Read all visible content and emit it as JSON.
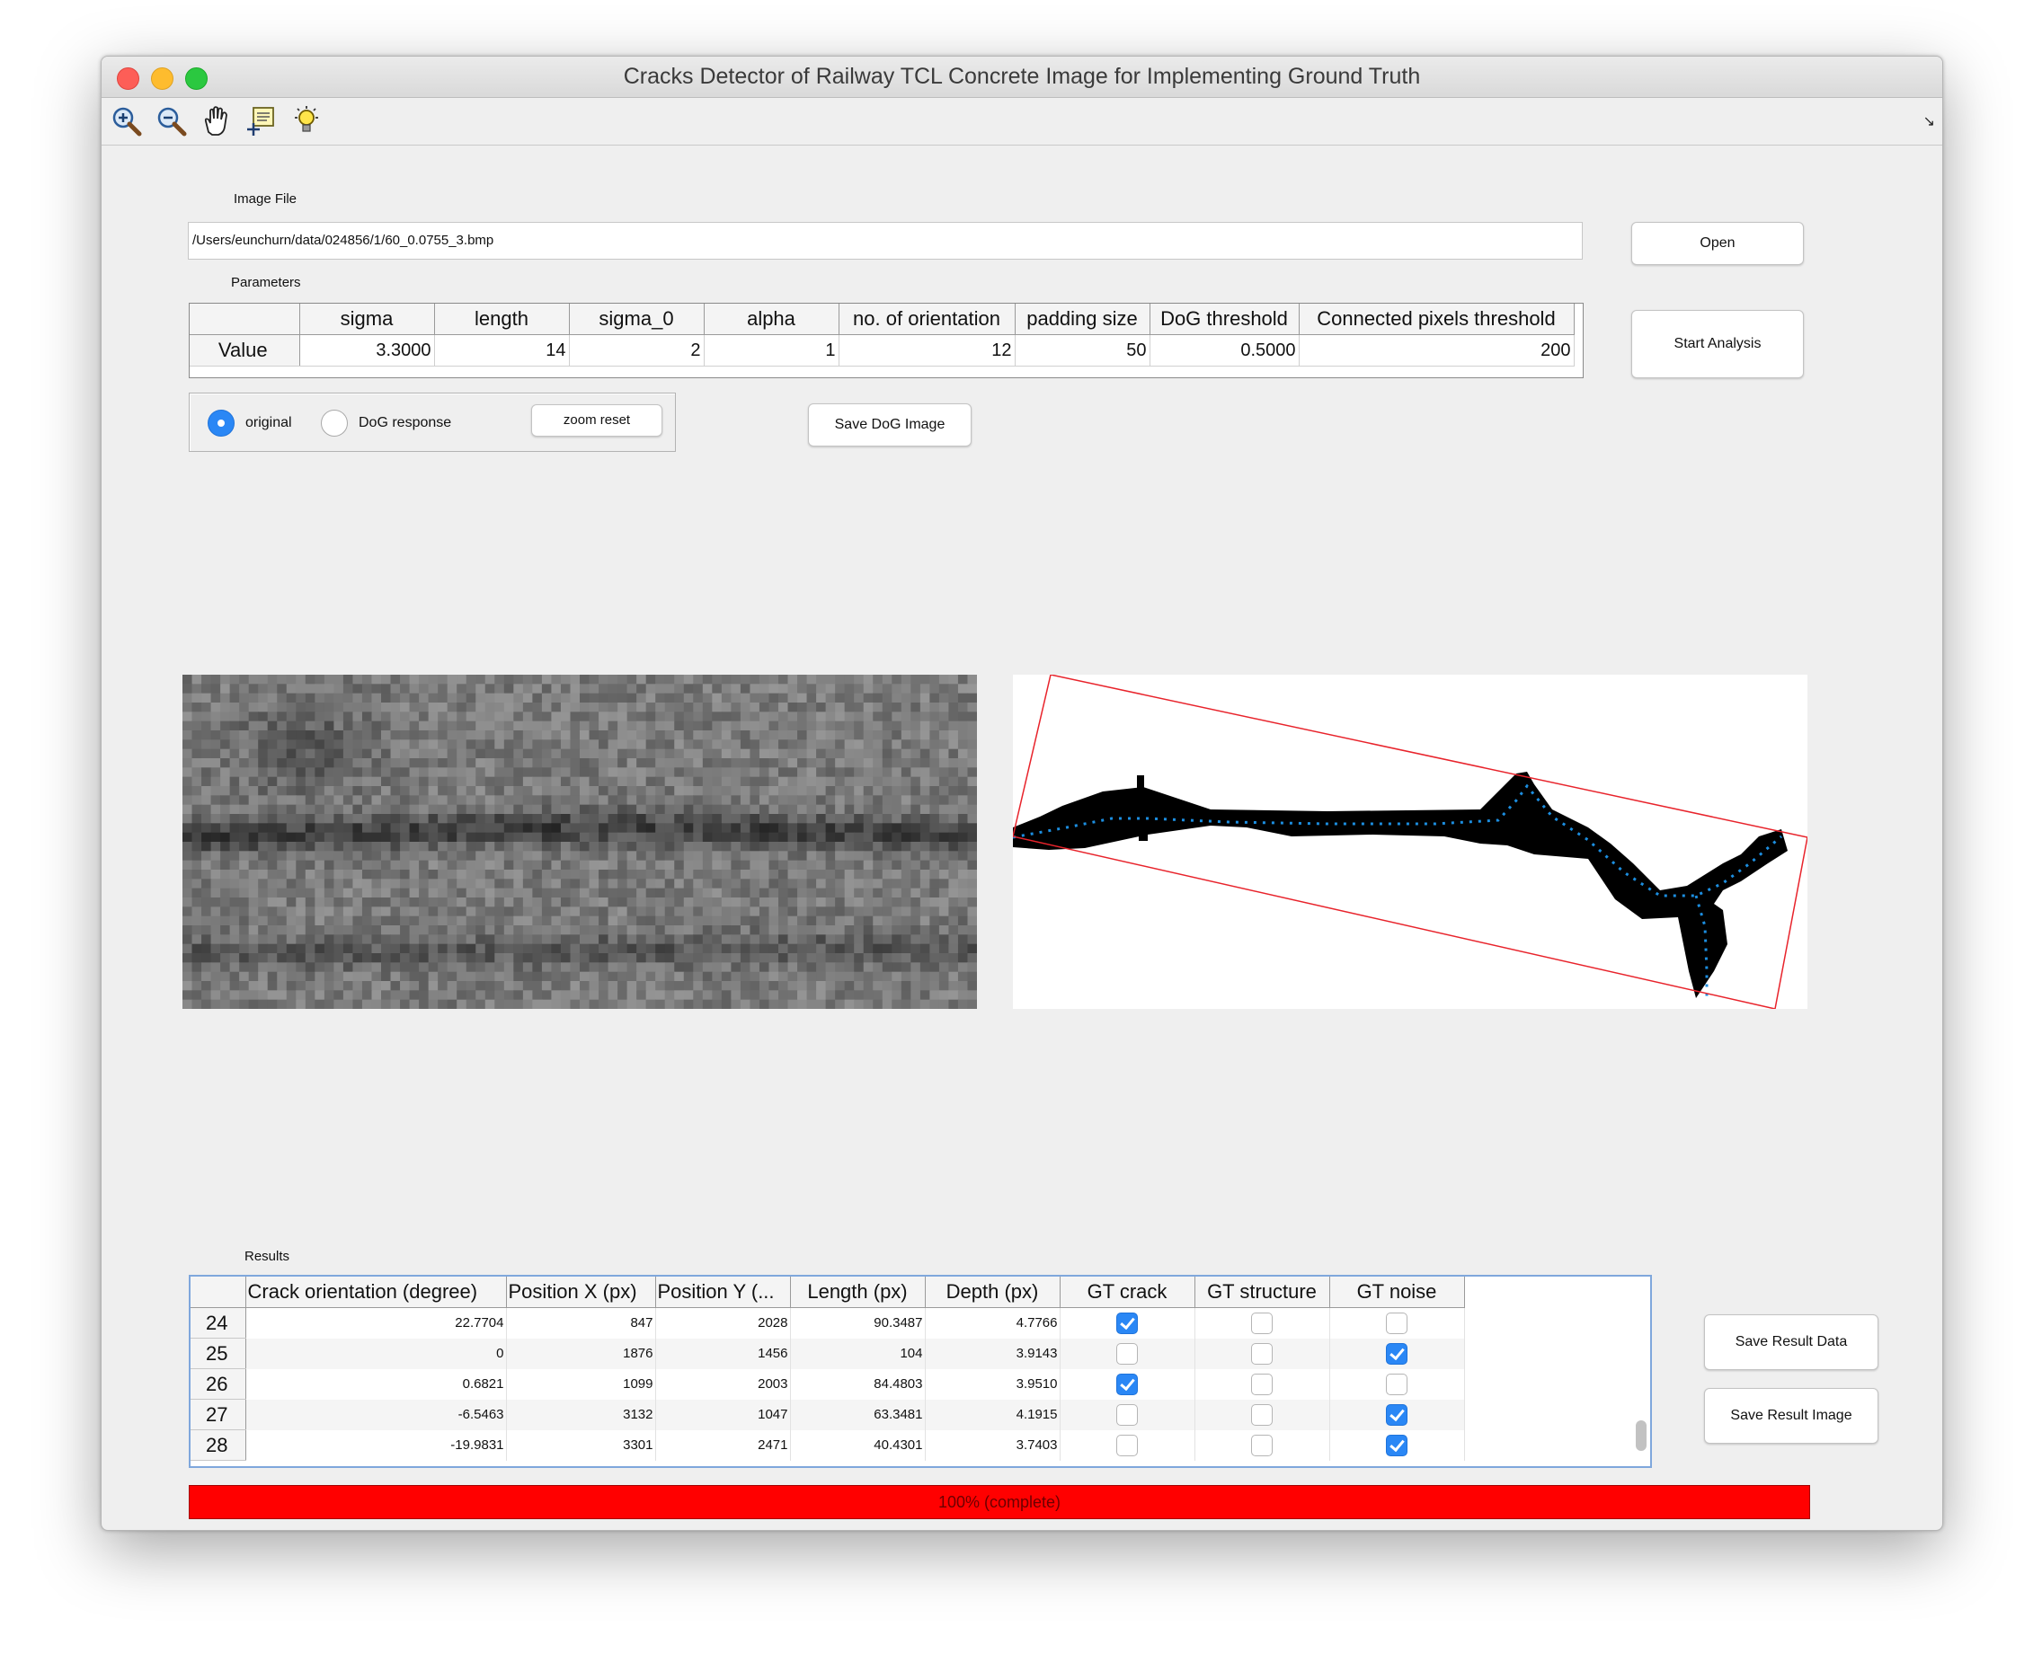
{
  "window": {
    "title": "Cracks Detector of Railway TCL Concrete Image for Implementing Ground Truth"
  },
  "toolbar": {
    "icons": [
      "zoom-in-icon",
      "zoom-out-icon",
      "pan-hand-icon",
      "data-cursor-icon",
      "lightbulb-icon"
    ]
  },
  "image_file": {
    "label": "Image File",
    "path": "/Users/eunchurn/data/024856/1/60_0.0755_3.bmp",
    "open_label": "Open"
  },
  "parameters": {
    "label": "Parameters",
    "row_label": "Value",
    "columns": [
      "sigma",
      "length",
      "sigma_0",
      "alpha",
      "no. of orientation",
      "padding size",
      "DoG threshold",
      "Connected pixels threshold"
    ],
    "values": [
      "3.3000",
      "14",
      "2",
      "1",
      "12",
      "50",
      "0.5000",
      "200"
    ],
    "start_label": "Start Analysis"
  },
  "view": {
    "original_label": "original",
    "dog_label": "DoG response",
    "selected": "original",
    "zoom_reset_label": "zoom reset",
    "save_dog_label": "Save DoG Image"
  },
  "results": {
    "label": "Results",
    "columns": [
      "Crack orientation (degree)",
      "Position X (px)",
      "Position Y (...",
      "Length (px)",
      "Depth (px)",
      "GT crack",
      "GT structure",
      "GT noise"
    ],
    "rows": [
      {
        "id": "24",
        "orientation": "22.7704",
        "x": "847",
        "y": "2028",
        "length": "90.3487",
        "depth": "4.7766",
        "gt_crack": true,
        "gt_structure": false,
        "gt_noise": false
      },
      {
        "id": "25",
        "orientation": "0",
        "x": "1876",
        "y": "1456",
        "length": "104",
        "depth": "3.9143",
        "gt_crack": false,
        "gt_structure": false,
        "gt_noise": true
      },
      {
        "id": "26",
        "orientation": "0.6821",
        "x": "1099",
        "y": "2003",
        "length": "84.4803",
        "depth": "3.9510",
        "gt_crack": true,
        "gt_structure": false,
        "gt_noise": false
      },
      {
        "id": "27",
        "orientation": "-6.5463",
        "x": "3132",
        "y": "1047",
        "length": "63.3481",
        "depth": "4.1915",
        "gt_crack": false,
        "gt_structure": false,
        "gt_noise": true
      },
      {
        "id": "28",
        "orientation": "-19.9831",
        "x": "3301",
        "y": "2471",
        "length": "40.4301",
        "depth": "3.7403",
        "gt_crack": false,
        "gt_structure": false,
        "gt_noise": true
      }
    ],
    "save_data_label": "Save Result Data",
    "save_image_label": "Save Result Image"
  },
  "progress": {
    "text": "100% (complete)",
    "fraction": 1.0,
    "color": "#ff0000"
  }
}
